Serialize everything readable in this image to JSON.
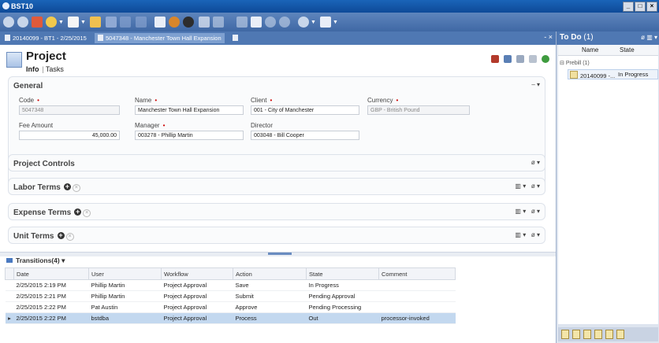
{
  "window": {
    "title": "BST10",
    "buttons": [
      "_",
      "□",
      "×"
    ]
  },
  "doc_tabs": [
    {
      "label": "20140099 - BT1 - 2/25/2015"
    },
    {
      "label": "5047348 - Manchester Town Hall Expansion"
    }
  ],
  "project": {
    "title": "Project",
    "tabs": [
      "Info",
      "Tasks"
    ],
    "general": {
      "title": "General",
      "code_label": "Code",
      "code": "5047348",
      "name_label": "Name",
      "name": "Manchester Town Hall Expansion",
      "client_label": "Client",
      "client": "001 - City of Manchester",
      "currency_label": "Currency",
      "currency": "GBP - British Pound",
      "fee_label": "Fee Amount",
      "fee": "45,000.00",
      "manager_label": "Manager",
      "manager": "003278 - Phillip Martin",
      "director_label": "Director",
      "director": "003048 - Bill Cooper"
    },
    "sections": [
      "Project Controls",
      "Labor Terms",
      "Expense Terms",
      "Unit Terms"
    ]
  },
  "transitions": {
    "title": "Transitions(4)",
    "columns": [
      "Date",
      "User",
      "Workflow",
      "Action",
      "State",
      "Comment"
    ],
    "rows": [
      [
        "2/25/2015 2:19 PM",
        "Phillip Martin",
        "Project Approval",
        "Save",
        "In Progress",
        ""
      ],
      [
        "2/25/2015 2:21 PM",
        "Phillip Martin",
        "Project Approval",
        "Submit",
        "Pending Approval",
        ""
      ],
      [
        "2/25/2015 2:22 PM",
        "Pat Austin",
        "Project Approval",
        "Approve",
        "Pending Processing",
        ""
      ],
      [
        "2/25/2015 2:22 PM",
        "bstdba",
        "Project Approval",
        "Process",
        "Out",
        "processor-invoked"
      ]
    ],
    "selected_row": 3
  },
  "todo": {
    "title": "To Do",
    "count": "(1)",
    "col_name": "Name",
    "col_state": "State",
    "group": "Prebill (1)",
    "item_name": "20140099 -...",
    "item_state": "In Progress"
  }
}
